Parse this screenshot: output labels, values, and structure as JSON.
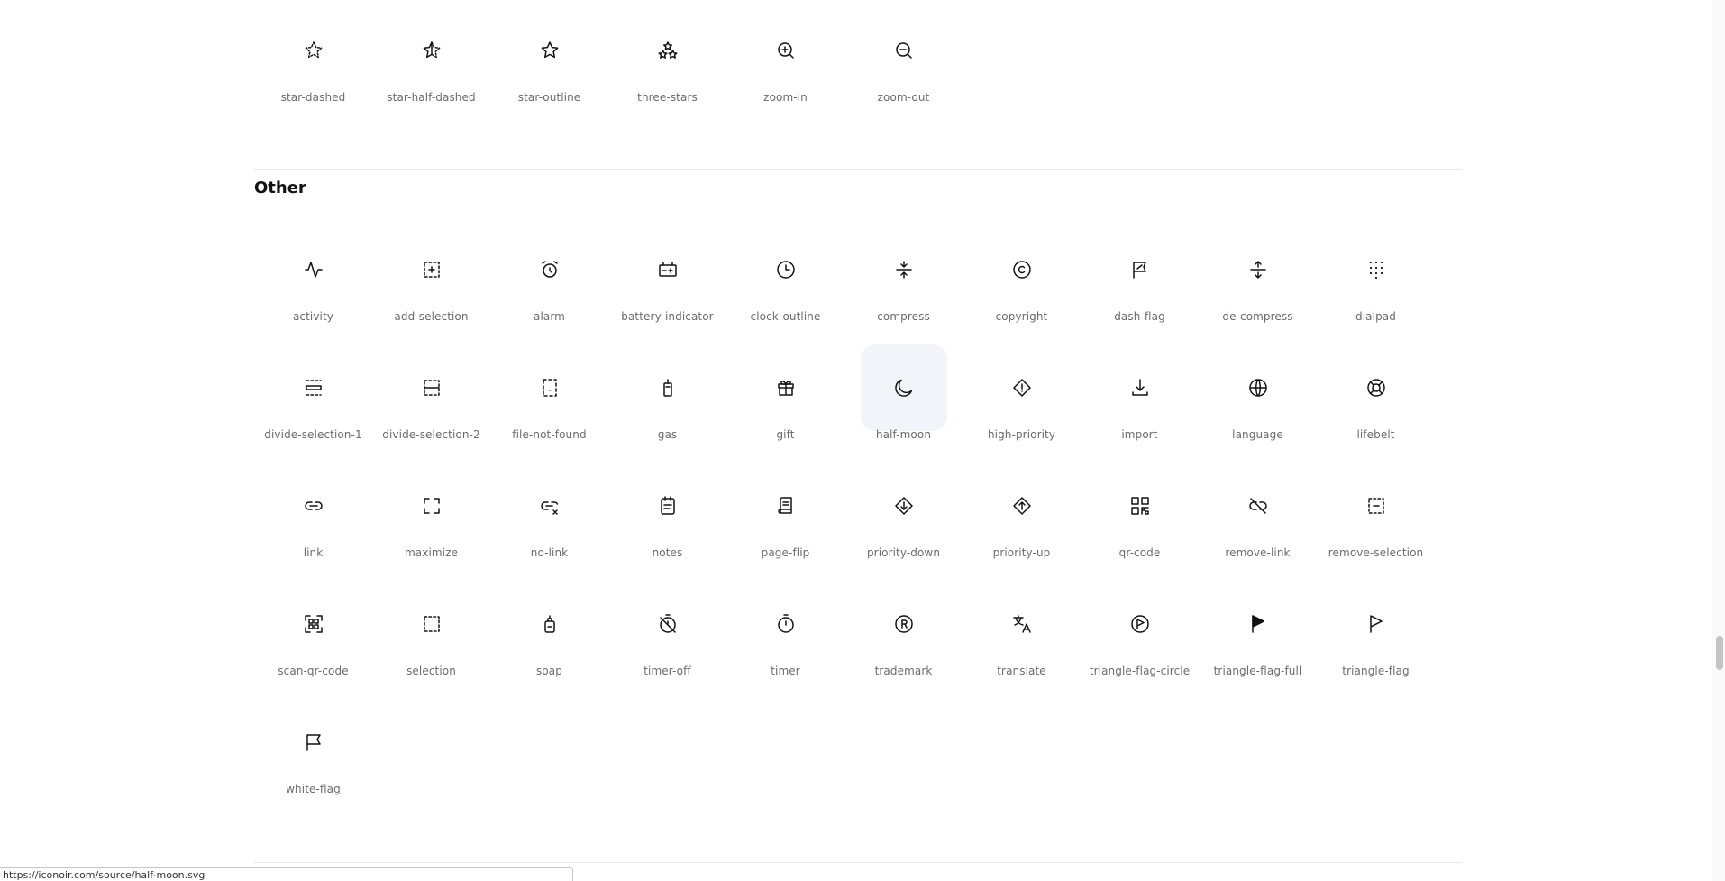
{
  "top_icons": [
    {
      "label": "star-dashed",
      "icon": "star-dashed-icon"
    },
    {
      "label": "star-half-dashed",
      "icon": "star-half-dashed-icon"
    },
    {
      "label": "star-outline",
      "icon": "star-outline-icon"
    },
    {
      "label": "three-stars",
      "icon": "three-stars-icon"
    },
    {
      "label": "zoom-in",
      "icon": "zoom-in-icon"
    },
    {
      "label": "zoom-out",
      "icon": "zoom-out-icon"
    }
  ],
  "other_section": {
    "title": "Other",
    "icons": [
      {
        "label": "activity",
        "icon": "activity-icon"
      },
      {
        "label": "add-selection",
        "icon": "add-selection-icon"
      },
      {
        "label": "alarm",
        "icon": "alarm-icon"
      },
      {
        "label": "battery-indicator",
        "icon": "battery-indicator-icon"
      },
      {
        "label": "clock-outline",
        "icon": "clock-outline-icon"
      },
      {
        "label": "compress",
        "icon": "compress-icon"
      },
      {
        "label": "copyright",
        "icon": "copyright-icon"
      },
      {
        "label": "dash-flag",
        "icon": "dash-flag-icon"
      },
      {
        "label": "de-compress",
        "icon": "de-compress-icon"
      },
      {
        "label": "dialpad",
        "icon": "dialpad-icon"
      },
      {
        "label": "divide-selection-1",
        "icon": "divide-selection-1-icon"
      },
      {
        "label": "divide-selection-2",
        "icon": "divide-selection-2-icon"
      },
      {
        "label": "file-not-found",
        "icon": "file-not-found-icon"
      },
      {
        "label": "gas",
        "icon": "gas-icon"
      },
      {
        "label": "gift",
        "icon": "gift-icon"
      },
      {
        "label": "half-moon",
        "icon": "half-moon-icon",
        "hovered": true
      },
      {
        "label": "high-priority",
        "icon": "high-priority-icon"
      },
      {
        "label": "import",
        "icon": "import-icon"
      },
      {
        "label": "language",
        "icon": "language-icon"
      },
      {
        "label": "lifebelt",
        "icon": "lifebelt-icon"
      },
      {
        "label": "link",
        "icon": "link-icon"
      },
      {
        "label": "maximize",
        "icon": "maximize-icon"
      },
      {
        "label": "no-link",
        "icon": "no-link-icon"
      },
      {
        "label": "notes",
        "icon": "notes-icon"
      },
      {
        "label": "page-flip",
        "icon": "page-flip-icon"
      },
      {
        "label": "priority-down",
        "icon": "priority-down-icon"
      },
      {
        "label": "priority-up",
        "icon": "priority-up-icon"
      },
      {
        "label": "qr-code",
        "icon": "qr-code-icon"
      },
      {
        "label": "remove-link",
        "icon": "remove-link-icon"
      },
      {
        "label": "remove-selection",
        "icon": "remove-selection-icon"
      },
      {
        "label": "scan-qr-code",
        "icon": "scan-qr-code-icon"
      },
      {
        "label": "selection",
        "icon": "selection-icon"
      },
      {
        "label": "soap",
        "icon": "soap-icon"
      },
      {
        "label": "timer-off",
        "icon": "timer-off-icon"
      },
      {
        "label": "timer",
        "icon": "timer-icon"
      },
      {
        "label": "trademark",
        "icon": "trademark-icon"
      },
      {
        "label": "translate",
        "icon": "translate-icon"
      },
      {
        "label": "triangle-flag-circle",
        "icon": "triangle-flag-circle-icon"
      },
      {
        "label": "triangle-flag-full",
        "icon": "triangle-flag-full-icon"
      },
      {
        "label": "triangle-flag",
        "icon": "triangle-flag-icon"
      },
      {
        "label": "white-flag",
        "icon": "white-flag-icon"
      }
    ]
  },
  "status_bar": {
    "url": "https://iconoir.com/source/half-moon.svg"
  },
  "colors": {
    "hover_tile": "#f1f5fa",
    "label_text": "#6b6b6b",
    "icon_stroke": "#121212"
  }
}
